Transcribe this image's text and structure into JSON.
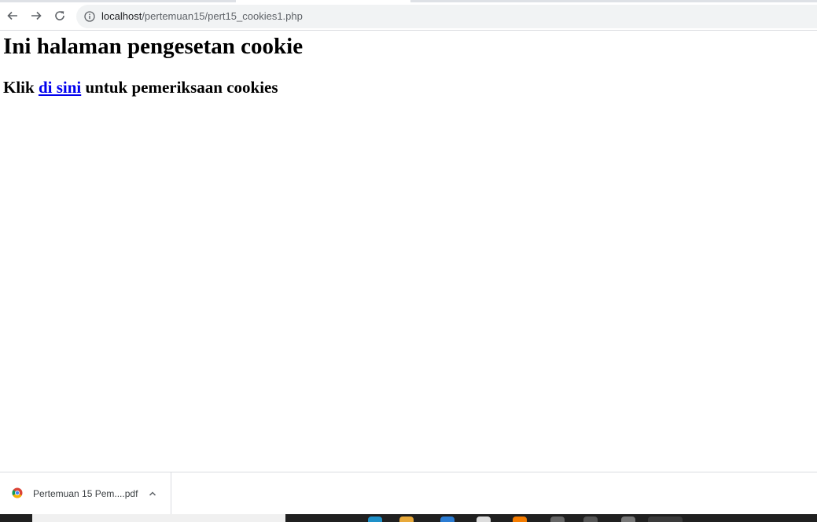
{
  "browser": {
    "url_host": "localhost",
    "url_path": "/pertemuan15/pert15_cookies1.php"
  },
  "page": {
    "heading": "Ini halaman pengesetan cookie",
    "sentence_prefix": "Klik",
    "link_text": "di sini",
    "sentence_suffix": "untuk pemeriksaan cookies"
  },
  "download_shelf": {
    "item_name": "Pertemuan 15 Pem....pdf"
  },
  "icons": {
    "back": "back-arrow-icon",
    "forward": "forward-arrow-icon",
    "reload": "reload-icon",
    "site_info": "info-icon",
    "download_file": "chrome-file-icon",
    "download_menu": "chevron-up-icon"
  },
  "colors": {
    "link": "#0000ee",
    "omnibox_bg": "#f1f3f4",
    "taskbar": "#202020"
  }
}
